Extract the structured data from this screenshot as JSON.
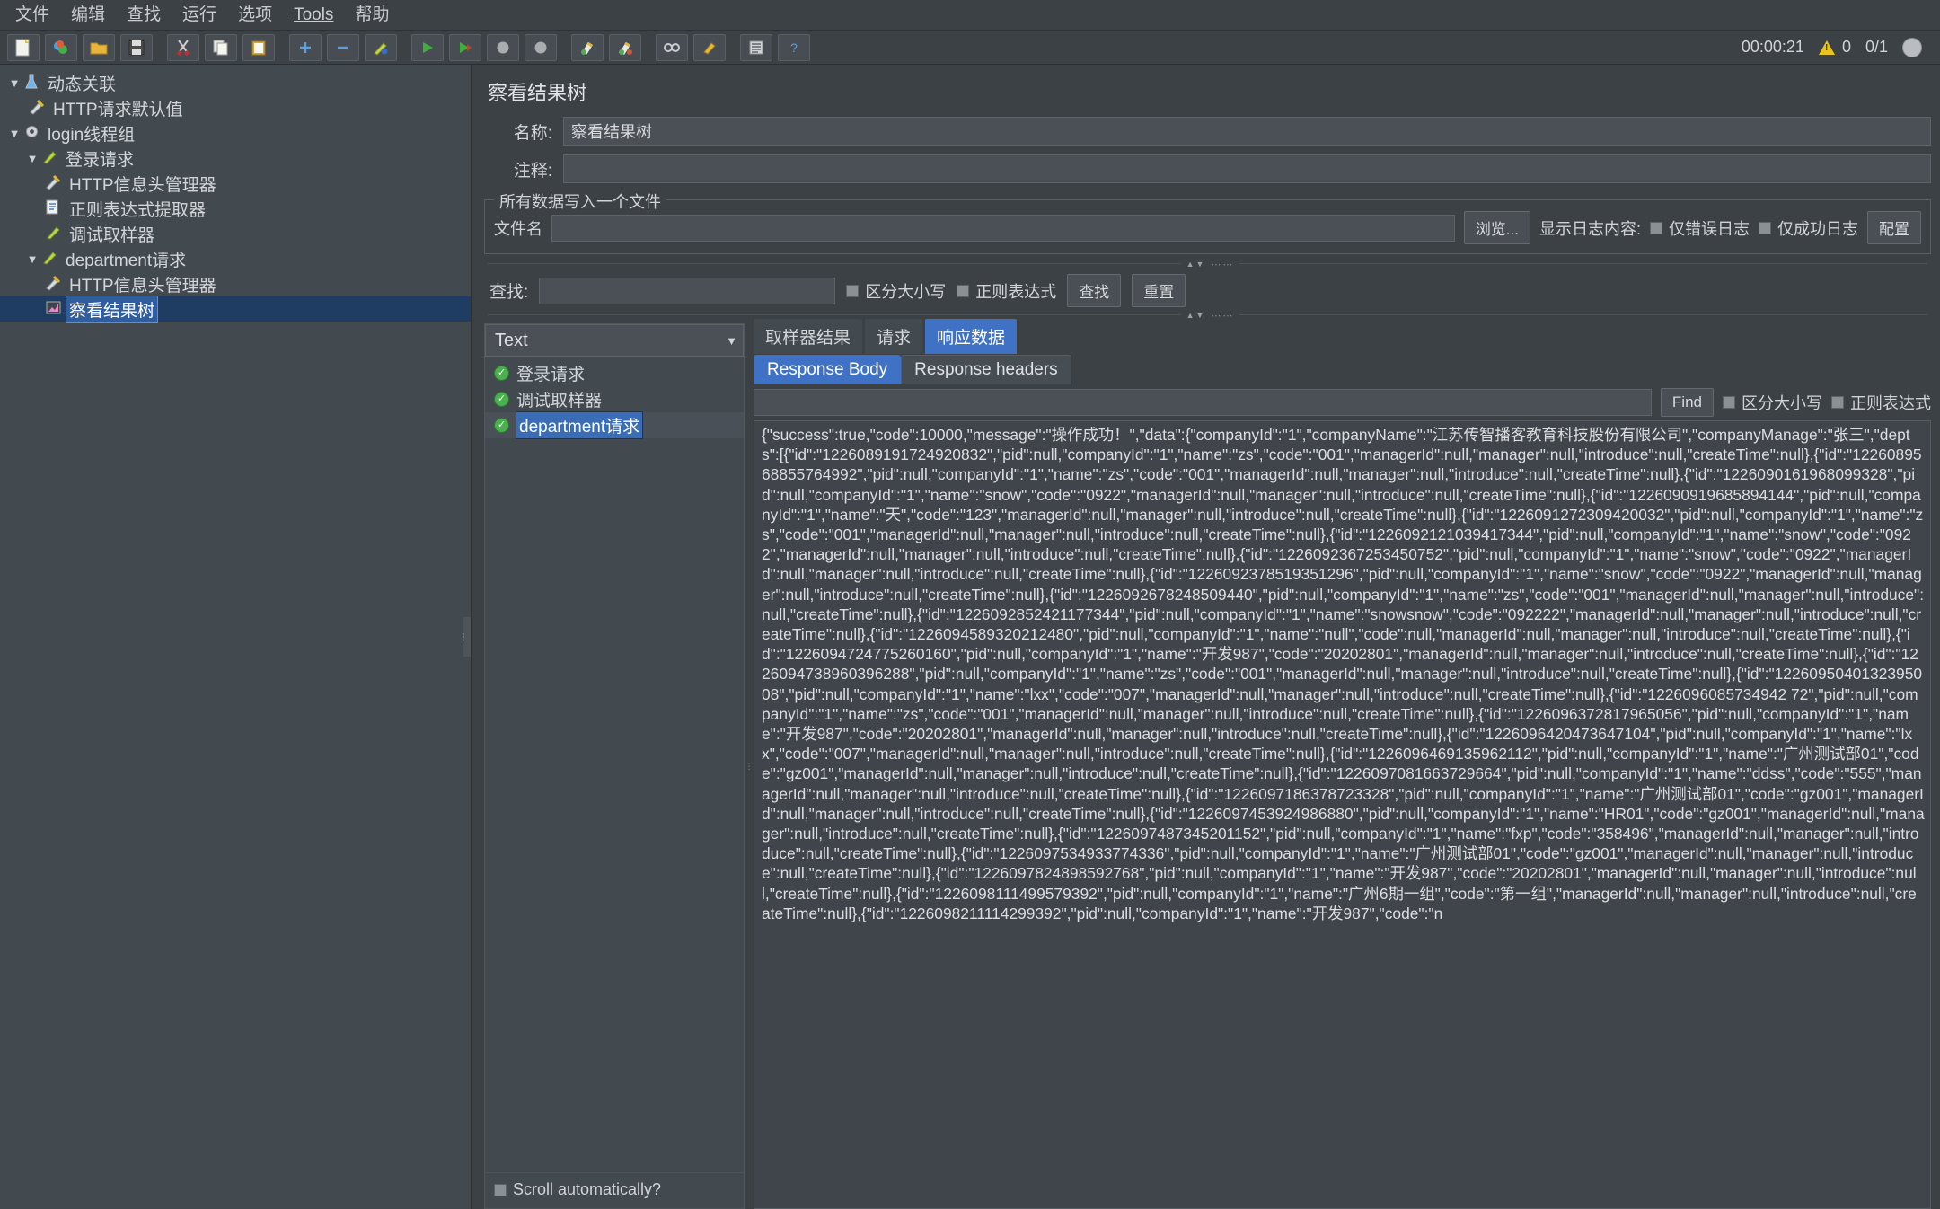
{
  "menu": {
    "items": [
      {
        "label": "文件"
      },
      {
        "label": "编辑"
      },
      {
        "label": "查找"
      },
      {
        "label": "运行"
      },
      {
        "label": "选项"
      },
      {
        "label": "Tools",
        "mnemonic": true
      },
      {
        "label": "帮助"
      }
    ]
  },
  "toolbar": {
    "buttons": [
      {
        "name": "new-icon",
        "glyph": "📄"
      },
      {
        "name": "templates-icon",
        "glyph": "🎨"
      },
      {
        "name": "open-icon",
        "glyph": "📂"
      },
      {
        "name": "save-icon",
        "glyph": "💾"
      },
      {
        "name": "cut-icon",
        "glyph": "✂"
      },
      {
        "name": "copy-icon",
        "glyph": "📑"
      },
      {
        "name": "paste-icon",
        "glyph": "📋"
      },
      {
        "name": "expand-all-icon",
        "glyph": "＋"
      },
      {
        "name": "collapse-all-icon",
        "glyph": "－"
      },
      {
        "name": "toggle-icon",
        "glyph": "🖊"
      },
      {
        "name": "start-icon",
        "glyph": "▶"
      },
      {
        "name": "start-no-pause-icon",
        "glyph": "▶"
      },
      {
        "name": "stop-icon",
        "glyph": "⬤"
      },
      {
        "name": "shutdown-icon",
        "glyph": "⬤"
      },
      {
        "name": "clear-icon",
        "glyph": "🧹"
      },
      {
        "name": "clear-all-icon",
        "glyph": "🧹"
      },
      {
        "name": "search-icon",
        "glyph": "🔍"
      },
      {
        "name": "reset-search-icon",
        "glyph": "🖌"
      },
      {
        "name": "function-helper-icon",
        "glyph": "▤"
      },
      {
        "name": "help-icon",
        "glyph": "?"
      }
    ],
    "timer": "00:00:21",
    "warning_count": "0",
    "threads": "0/1"
  },
  "tree": {
    "items": [
      {
        "label": "动态关联",
        "indent": 0,
        "twisty": "▼",
        "icon": "test-plan-icon",
        "glyph": "🧪",
        "selected": false
      },
      {
        "label": "HTTP请求默认值",
        "indent": 1,
        "twisty": "",
        "icon": "config-element-icon",
        "glyph": "🛠",
        "selected": false
      },
      {
        "label": "login线程组",
        "indent": 0,
        "twisty": "▼",
        "icon": "thread-group-icon",
        "glyph": "⚙",
        "selected": false
      },
      {
        "label": "登录请求",
        "indent": 1,
        "twisty": "▼",
        "icon": "http-sampler-icon",
        "glyph": "🖊",
        "selected": false
      },
      {
        "label": "HTTP信息头管理器",
        "indent": 2,
        "twisty": "",
        "icon": "header-manager-icon",
        "glyph": "🛠",
        "selected": false
      },
      {
        "label": "正则表达式提取器",
        "indent": 2,
        "twisty": "",
        "icon": "post-processor-icon",
        "glyph": "📘",
        "selected": false
      },
      {
        "label": "调试取样器",
        "indent": 2,
        "twisty": "",
        "icon": "debug-sampler-icon",
        "glyph": "🖊",
        "selected": false
      },
      {
        "label": "department请求",
        "indent": 1,
        "twisty": "▼",
        "icon": "http-sampler-icon",
        "glyph": "🖊",
        "selected": false
      },
      {
        "label": "HTTP信息头管理器",
        "indent": 2,
        "twisty": "",
        "icon": "header-manager-icon",
        "glyph": "🛠",
        "selected": false
      },
      {
        "label": "察看结果树",
        "indent": 2,
        "twisty": "",
        "icon": "view-results-tree-icon",
        "glyph": "📊",
        "selected": true
      }
    ]
  },
  "panel": {
    "title": "察看结果树",
    "name_label": "名称:",
    "name_value": "察看结果树",
    "comment_label": "注释:",
    "comment_value": "",
    "filegroup": {
      "title": "所有数据写入一个文件",
      "filename_label": "文件名",
      "filename_value": "",
      "browse_label": "浏览...",
      "log_display_label": "显示日志内容:",
      "errors_only_label": "仅错误日志",
      "successes_only_label": "仅成功日志",
      "configure_label": "配置"
    },
    "search": {
      "label": "查找:",
      "value": "",
      "case_sensitive_label": "区分大小写",
      "regex_label": "正则表达式",
      "find_button": "查找",
      "reset_button": "重置"
    }
  },
  "results": {
    "renderer_selected": "Text",
    "samples": [
      {
        "label": "登录请求",
        "status": "success",
        "selected": false
      },
      {
        "label": "调试取样器",
        "status": "success",
        "selected": false
      },
      {
        "label": "department请求",
        "status": "success",
        "selected": true
      }
    ],
    "scroll_automatically_label": "Scroll automatically?",
    "tabs": [
      {
        "label": "取样器结果",
        "active": false
      },
      {
        "label": "请求",
        "active": false
      },
      {
        "label": "响应数据",
        "active": true
      }
    ],
    "subtabs": [
      {
        "label": "Response Body",
        "active": true
      },
      {
        "label": "Response headers",
        "active": false
      }
    ],
    "find": {
      "value": "",
      "button_label": "Find",
      "case_sensitive_label": "区分大小写",
      "regex_label": "正则表达式"
    },
    "response_body": "{\"success\":true,\"code\":10000,\"message\":\"操作成功！\",\"data\":{\"companyId\":\"1\",\"companyName\":\"江苏传智播客教育科技股份有限公司\",\"companyManage\":\"张三\",\"depts\":[{\"id\":\"1226089191724920832\",\"pid\":null,\"companyId\":\"1\",\"name\":\"zs\",\"code\":\"001\",\"managerId\":null,\"manager\":null,\"introduce\":null,\"createTime\":null},{\"id\":\"1226089568855764992\",\"pid\":null,\"companyId\":\"1\",\"name\":\"zs\",\"code\":\"001\",\"managerId\":null,\"manager\":null,\"introduce\":null,\"createTime\":null},{\"id\":\"1226090161968099328\",\"pid\":null,\"companyId\":\"1\",\"name\":\"snow\",\"code\":\"0922\",\"managerId\":null,\"manager\":null,\"introduce\":null,\"createTime\":null},{\"id\":\"1226090919685894144\",\"pid\":null,\"companyId\":\"1\",\"name\":\"天\",\"code\":\"123\",\"managerId\":null,\"manager\":null,\"introduce\":null,\"createTime\":null},{\"id\":\"1226091272309420032\",\"pid\":null,\"companyId\":\"1\",\"name\":\"zs\",\"code\":\"001\",\"managerId\":null,\"manager\":null,\"introduce\":null,\"createTime\":null},{\"id\":\"1226092121039417344\",\"pid\":null,\"companyId\":\"1\",\"name\":\"snow\",\"code\":\"0922\",\"managerId\":null,\"manager\":null,\"introduce\":null,\"createTime\":null},{\"id\":\"1226092367253450752\",\"pid\":null,\"companyId\":\"1\",\"name\":\"snow\",\"code\":\"0922\",\"managerId\":null,\"manager\":null,\"introduce\":null,\"createTime\":null},{\"id\":\"1226092378519351296\",\"pid\":null,\"companyId\":\"1\",\"name\":\"snow\",\"code\":\"0922\",\"managerId\":null,\"manager\":null,\"introduce\":null,\"createTime\":null},{\"id\":\"1226092678248509440\",\"pid\":null,\"companyId\":\"1\",\"name\":\"zs\",\"code\":\"001\",\"managerId\":null,\"manager\":null,\"introduce\":null,\"createTime\":null},{\"id\":\"1226092852421177344\",\"pid\":null,\"companyId\":\"1\",\"name\":\"snowsnow\",\"code\":\"092222\",\"managerId\":null,\"manager\":null,\"introduce\":null,\"createTime\":null},{\"id\":\"1226094589320212480\",\"pid\":null,\"companyId\":\"1\",\"name\":\"null\",\"code\":null,\"managerId\":null,\"manager\":null,\"introduce\":null,\"createTime\":null},{\"id\":\"1226094724775260160\",\"pid\":null,\"companyId\":\"1\",\"name\":\"开发987\",\"code\":\"20202801\",\"managerId\":null,\"manager\":null,\"introduce\":null,\"createTime\":null},{\"id\":\"1226094738960396288\",\"pid\":null,\"companyId\":\"1\",\"name\":\"zs\",\"code\":\"001\",\"managerId\":null,\"manager\":null,\"introduce\":null,\"createTime\":null},{\"id\":\"1226095040132395008\",\"pid\":null,\"companyId\":\"1\",\"name\":\"lxx\",\"code\":\"007\",\"managerId\":null,\"manager\":null,\"introduce\":null,\"createTime\":null},{\"id\":\"1226096085734942 72\",\"pid\":null,\"companyId\":\"1\",\"name\":\"zs\",\"code\":\"001\",\"managerId\":null,\"manager\":null,\"introduce\":null,\"createTime\":null},{\"id\":\"1226096372817965056\",\"pid\":null,\"companyId\":\"1\",\"name\":\"开发987\",\"code\":\"20202801\",\"managerId\":null,\"manager\":null,\"introduce\":null,\"createTime\":null},{\"id\":\"1226096420473647104\",\"pid\":null,\"companyId\":\"1\",\"name\":\"lxx\",\"code\":\"007\",\"managerId\":null,\"manager\":null,\"introduce\":null,\"createTime\":null},{\"id\":\"1226096469135962112\",\"pid\":null,\"companyId\":\"1\",\"name\":\"广州测试部01\",\"code\":\"gz001\",\"managerId\":null,\"manager\":null,\"introduce\":null,\"createTime\":null},{\"id\":\"1226097081663729664\",\"pid\":null,\"companyId\":\"1\",\"name\":\"ddss\",\"code\":\"555\",\"managerId\":null,\"manager\":null,\"introduce\":null,\"createTime\":null},{\"id\":\"1226097186378723328\",\"pid\":null,\"companyId\":\"1\",\"name\":\"广州测试部01\",\"code\":\"gz001\",\"managerId\":null,\"manager\":null,\"introduce\":null,\"createTime\":null},{\"id\":\"1226097453924986880\",\"pid\":null,\"companyId\":\"1\",\"name\":\"HR01\",\"code\":\"gz001\",\"managerId\":null,\"manager\":null,\"introduce\":null,\"createTime\":null},{\"id\":\"1226097487345201152\",\"pid\":null,\"companyId\":\"1\",\"name\":\"fxp\",\"code\":\"358496\",\"managerId\":null,\"manager\":null,\"introduce\":null,\"createTime\":null},{\"id\":\"1226097534933774336\",\"pid\":null,\"companyId\":\"1\",\"name\":\"广州测试部01\",\"code\":\"gz001\",\"managerId\":null,\"manager\":null,\"introduce\":null,\"createTime\":null},{\"id\":\"1226097824898592768\",\"pid\":null,\"companyId\":\"1\",\"name\":\"开发987\",\"code\":\"20202801\",\"managerId\":null,\"manager\":null,\"introduce\":null,\"createTime\":null},{\"id\":\"1226098111499579392\",\"pid\":null,\"companyId\":\"1\",\"name\":\"广州6期一组\",\"code\":\"第一组\",\"managerId\":null,\"manager\":null,\"introduce\":null,\"createTime\":null},{\"id\":\"1226098211114299392\",\"pid\":null,\"companyId\":\"1\",\"name\":\"开发987\",\"code\":\"n"
  },
  "colors": {
    "accent": "#3f72c4",
    "selection": "#2f5d9e",
    "window_bg": "#3c4145",
    "panel_bg": "#434a4f",
    "warning": "#e8c51d",
    "success": "#4caf50"
  }
}
